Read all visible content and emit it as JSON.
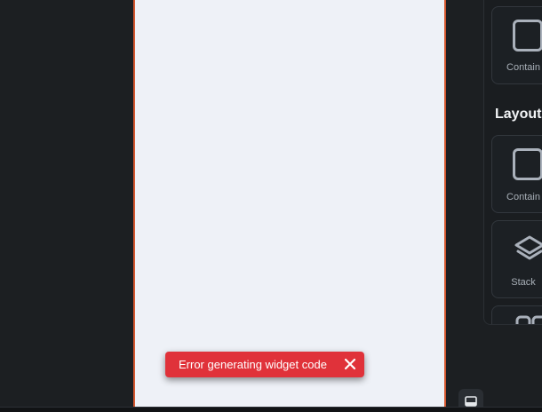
{
  "toast": {
    "message": "Error generating widget code",
    "close_icon": "close-icon",
    "color": "#e0323a"
  },
  "widget_panel": {
    "top_items": [
      {
        "label": "Contain",
        "icon": "container-icon"
      }
    ],
    "section_title": "Layout",
    "layout_items": [
      {
        "label": "Contain",
        "icon": "container-icon"
      },
      {
        "label": "Stack",
        "icon": "stack-layers-icon"
      }
    ]
  },
  "canvas": {
    "border_color": "#d4572f",
    "background": "#eef1f7"
  },
  "panel_toggle": {
    "icon": "bottom-panel-icon"
  }
}
